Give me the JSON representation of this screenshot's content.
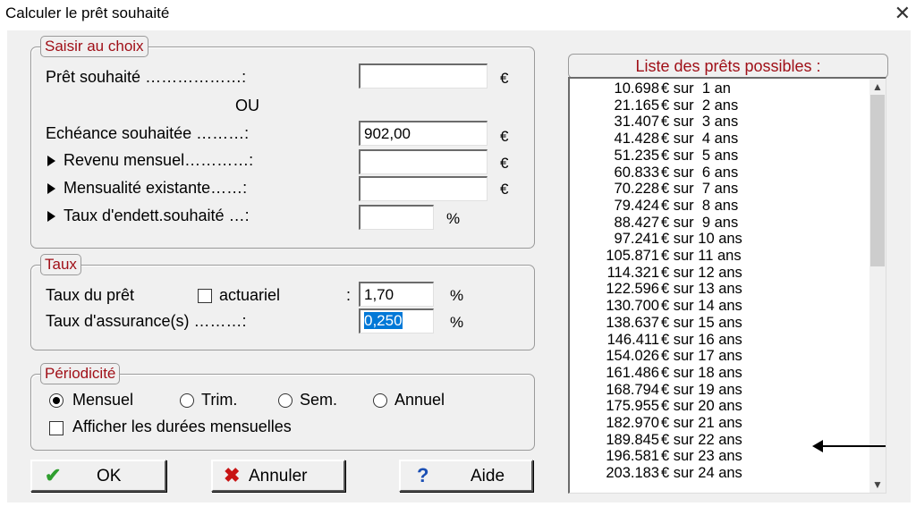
{
  "window": {
    "title": "Calculer le prêt souhaité",
    "close_glyph": "✕"
  },
  "saisir": {
    "legend": "Saisir au choix",
    "pret_label": "Prêt souhaité ………………:",
    "pret_value": "",
    "pret_unit": "€",
    "ou": "OU",
    "echeance_label": "Echéance souhaitée ………:",
    "echeance_value": "902,00",
    "echeance_unit": "€",
    "revenu_label": "Revenu mensuel…………:",
    "revenu_value": "",
    "revenu_unit": "€",
    "mensualite_label": "Mensualité existante……:",
    "mensualite_value": "",
    "mensualite_unit": "€",
    "taux_endett_label": "Taux d'endett.souhaité …:",
    "taux_endett_value": "",
    "taux_endett_unit": "%"
  },
  "taux": {
    "legend": "Taux",
    "pret_label": "Taux du prêt",
    "actuariel_label": "actuariel",
    "actuariel_checked": false,
    "colon": ":",
    "pret_value": "1,70",
    "pret_unit": "%",
    "assurance_label": "Taux d'assurance(s) ………:",
    "assurance_value": "0,250",
    "assurance_unit": "%"
  },
  "periodicite": {
    "legend": "Périodicité",
    "options": [
      "Mensuel",
      "Trim.",
      "Sem.",
      "Annuel"
    ],
    "selected": "Mensuel",
    "afficher_label": "Afficher les durées mensuelles",
    "afficher_checked": false
  },
  "buttons": {
    "ok": "OK",
    "annuler": "Annuler",
    "aide": "Aide"
  },
  "list": {
    "header": "Liste des prêts possibles :",
    "rows": [
      {
        "amount": "10.698",
        "term": "€ sur  1 an"
      },
      {
        "amount": "21.165",
        "term": "€ sur  2 ans"
      },
      {
        "amount": "31.407",
        "term": "€ sur  3 ans"
      },
      {
        "amount": "41.428",
        "term": "€ sur  4 ans"
      },
      {
        "amount": "51.235",
        "term": "€ sur  5 ans"
      },
      {
        "amount": "60.833",
        "term": "€ sur  6 ans"
      },
      {
        "amount": "70.228",
        "term": "€ sur  7 ans"
      },
      {
        "amount": "79.424",
        "term": "€ sur  8 ans"
      },
      {
        "amount": "88.427",
        "term": "€ sur  9 ans"
      },
      {
        "amount": "97.241",
        "term": "€ sur 10 ans"
      },
      {
        "amount": "105.871",
        "term": "€ sur 11 ans"
      },
      {
        "amount": "114.321",
        "term": "€ sur 12 ans"
      },
      {
        "amount": "122.596",
        "term": "€ sur 13 ans"
      },
      {
        "amount": "130.700",
        "term": "€ sur 14 ans"
      },
      {
        "amount": "138.637",
        "term": "€ sur 15 ans"
      },
      {
        "amount": "146.411",
        "term": "€ sur 16 ans"
      },
      {
        "amount": "154.026",
        "term": "€ sur 17 ans"
      },
      {
        "amount": "161.486",
        "term": "€ sur 18 ans"
      },
      {
        "amount": "168.794",
        "term": "€ sur 19 ans"
      },
      {
        "amount": "175.955",
        "term": "€ sur 20 ans"
      },
      {
        "amount": "182.970",
        "term": "€ sur 21 ans"
      },
      {
        "amount": "189.845",
        "term": "€ sur 22 ans"
      },
      {
        "amount": "196.581",
        "term": "€ sur 23 ans"
      },
      {
        "amount": "203.183",
        "term": "€ sur 24 ans"
      }
    ],
    "highlighted_row": "175.955 € sur 20 ans"
  },
  "icons": {
    "scroll_up": "scroll-up-icon",
    "scroll_down": "scroll-down-icon",
    "ok": "check-icon",
    "annuler": "x-icon",
    "aide": "help-icon",
    "annotation": "arrow-icon"
  },
  "colors": {
    "legend_text": "#a01018",
    "ok_check": "#2f9e2f",
    "annuler_x": "#c81414",
    "aide_q": "#1a4fb4",
    "selection": "#0078d7"
  }
}
